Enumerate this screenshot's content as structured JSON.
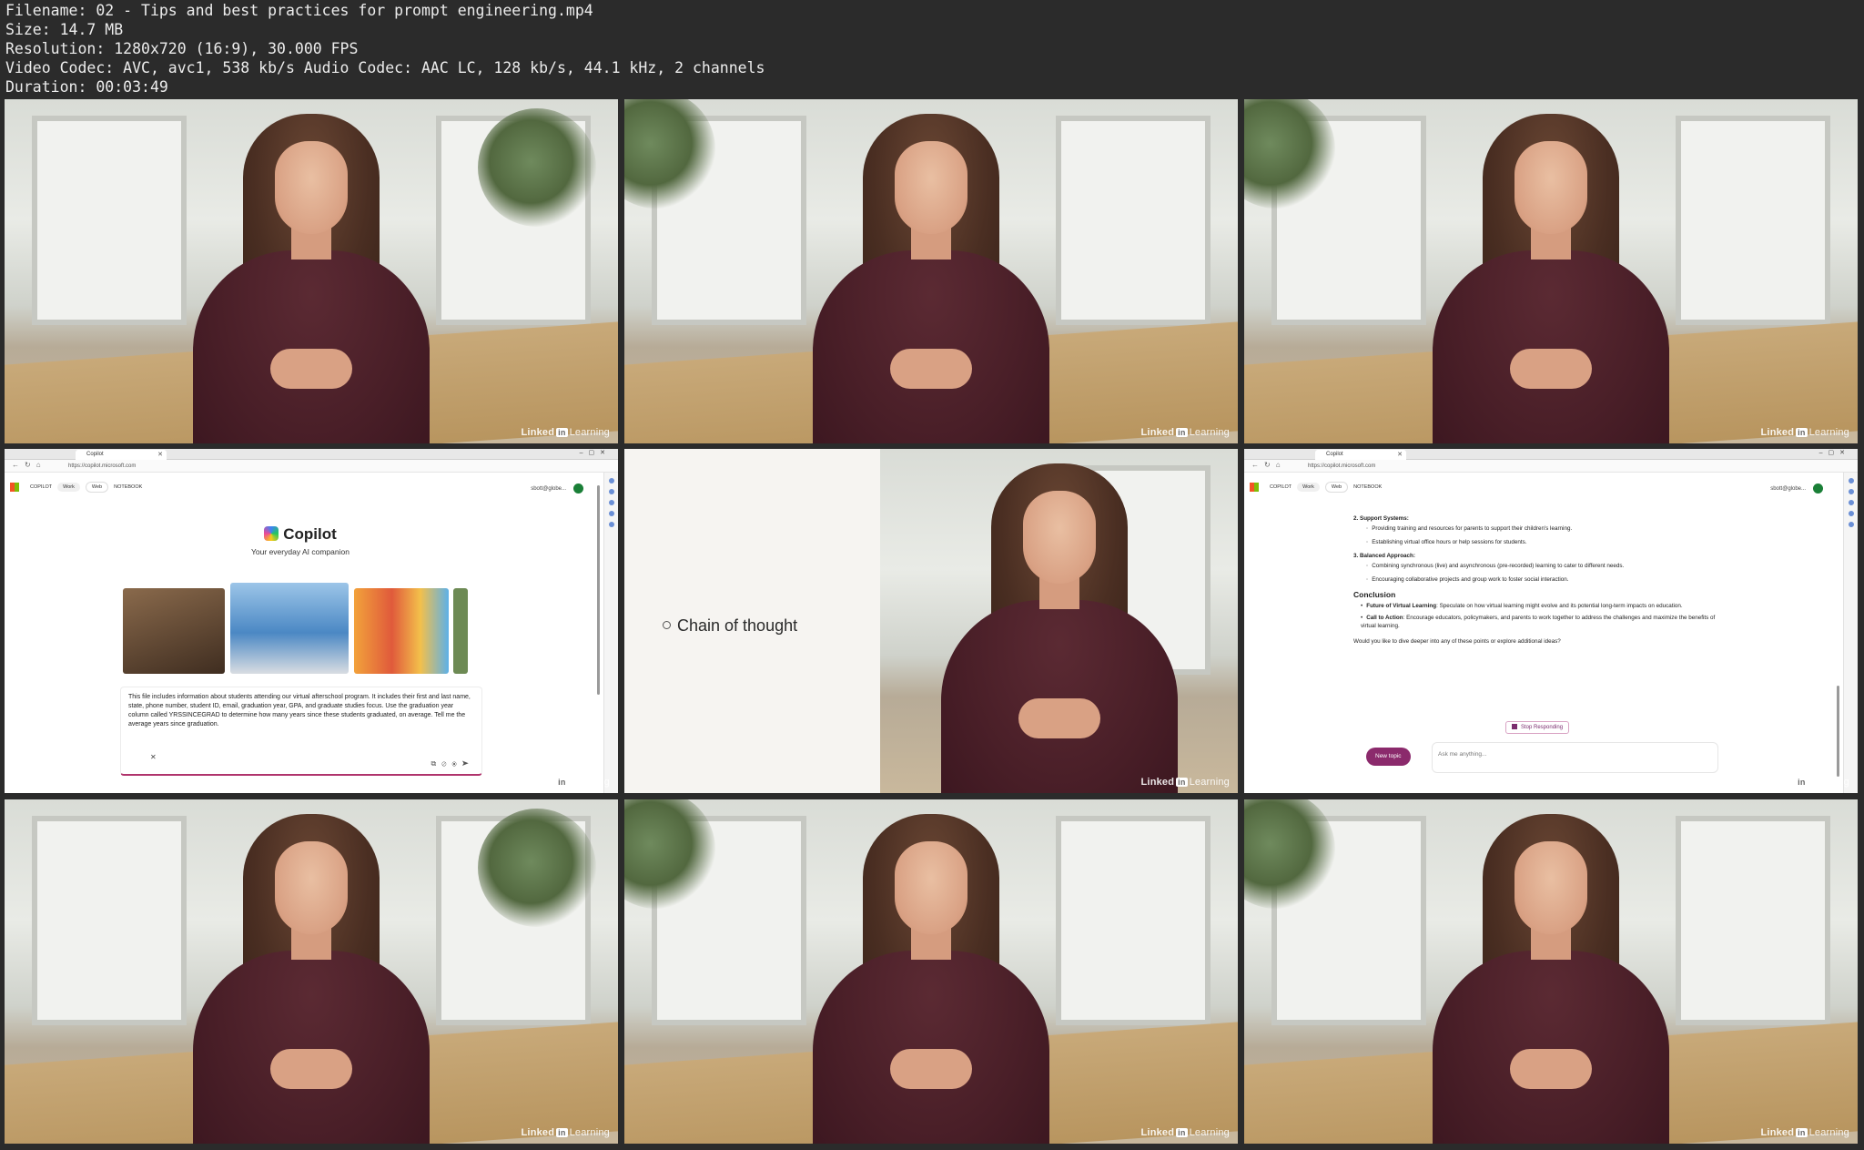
{
  "header": {
    "filename": "Filename: 02 - Tips and best practices for prompt engineering.mp4",
    "size": "Size: 14.7 MB",
    "resolution": "Resolution: 1280x720 (16:9), 30.000 FPS",
    "codec": "Video Codec: AVC, avc1, 538 kb/s Audio Codec: AAC LC, 128 kb/s, 44.1 kHz, 2 channels",
    "duration": "Duration: 00:03:49"
  },
  "watermark": {
    "brand": "Linked",
    "in": "in",
    "suffix": "Learning"
  },
  "copilot_home": {
    "tab_title": "Copilot",
    "url": "https://copilot.microsoft.com",
    "tab_copilot": "COPILOT",
    "tab_work": "Work",
    "tab_web": "Web",
    "tab_notebook": "NOTEBOOK",
    "user": "sbott@globe...",
    "title": "Copilot",
    "subtitle": "Your everyday AI companion",
    "prompt": "This file includes information about students attending our virtual afterschool program. It includes their first and last name, state, phone number, student ID, email, graduation year, GPA, and graduate studies focus. Use the graduation year column called YRSSINCEGRAD to determine how many years since these students graduated, on average. Tell me the average years since graduation."
  },
  "slide": {
    "bullet": "Chain of thought"
  },
  "copilot_answer": {
    "section_support": "2. Support Systems:",
    "support_1": "Providing training and resources for parents to support their children's learning.",
    "support_2": "Establishing virtual office hours or help sessions for students.",
    "section_balanced": "3. Balanced Approach:",
    "balanced_1": "Combining synchronous (live) and asynchronous (pre-recorded) learning to cater to different needs.",
    "balanced_2": "Encouraging collaborative projects and group work to foster social interaction.",
    "conclusion": "Conclusion",
    "future_label": "Future of Virtual Learning",
    "future_text": ": Speculate on how virtual learning might evolve and its potential long-term impacts on education.",
    "cta_label": "Call to Action",
    "cta_text": ": Encourage educators, policymakers, and parents to work together to address the challenges and maximize the benefits of virtual learning.",
    "question": "Would you like to dive deeper into any of these points or explore additional ideas?",
    "stop": "Stop Responding",
    "new_topic": "New topic",
    "ask_placeholder": "Ask me anything..."
  }
}
